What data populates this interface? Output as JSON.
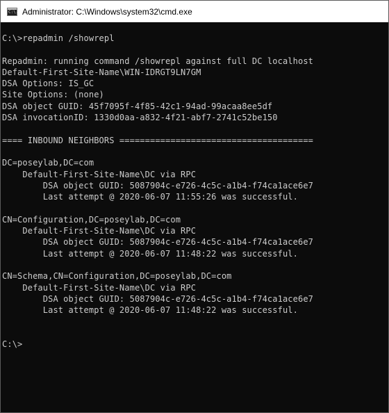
{
  "window": {
    "title": "Administrator: C:\\Windows\\system32\\cmd.exe",
    "icon": "cmd-icon",
    "icon_text": "C:\\."
  },
  "console": {
    "background": "#0c0c0c",
    "foreground": "#cccccc",
    "lines": [
      "C:\\>repadmin /showrepl",
      "",
      "Repadmin: running command /showrepl against full DC localhost",
      "Default-First-Site-Name\\WIN-IDRGT9LN7GM",
      "DSA Options: IS_GC",
      "Site Options: (none)",
      "DSA object GUID: 45f7095f-4f85-42c1-94ad-99acaa8ee5df",
      "DSA invocationID: 1330d0aa-a832-4f21-abf7-2741c52be150",
      "",
      "==== INBOUND NEIGHBORS ======================================",
      "",
      "DC=poseylab,DC=com",
      "    Default-First-Site-Name\\DC via RPC",
      "        DSA object GUID: 5087904c-e726-4c5c-a1b4-f74ca1ace6e7",
      "        Last attempt @ 2020-06-07 11:55:26 was successful.",
      "",
      "CN=Configuration,DC=poseylab,DC=com",
      "    Default-First-Site-Name\\DC via RPC",
      "        DSA object GUID: 5087904c-e726-4c5c-a1b4-f74ca1ace6e7",
      "        Last attempt @ 2020-06-07 11:48:22 was successful.",
      "",
      "CN=Schema,CN=Configuration,DC=poseylab,DC=com",
      "    Default-First-Site-Name\\DC via RPC",
      "        DSA object GUID: 5087904c-e726-4c5c-a1b4-f74ca1ace6e7",
      "        Last attempt @ 2020-06-07 11:48:22 was successful.",
      "",
      "",
      "C:\\>"
    ]
  }
}
